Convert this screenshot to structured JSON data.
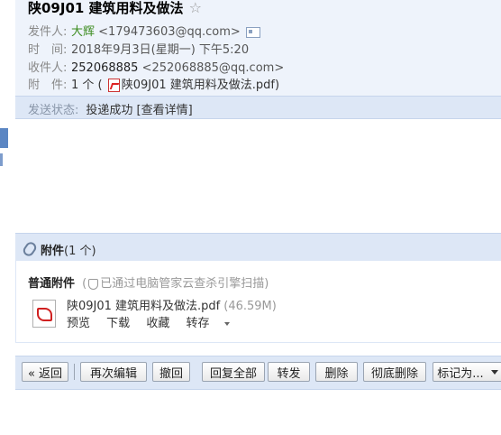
{
  "mail": {
    "subject": "陕09J01 建筑用料及做法",
    "star": "☆",
    "sender": {
      "label": "发件人:",
      "name": "大辉",
      "email": "<179473603@qq.com>"
    },
    "time": {
      "label": "时　间:",
      "value": "2018年9月3日(星期一) 下午5:20"
    },
    "recipient": {
      "label": "收件人:",
      "name": "252068885",
      "email": "<252068885@qq.com>"
    },
    "attachment_summary": {
      "label": "附　件:",
      "prefix": "1 个 (",
      "file": "陕09J01 建筑用料及做法.pdf",
      "suffix": ")"
    },
    "status": {
      "label": "发送状态:",
      "value": "投递成功 [查看详情]"
    }
  },
  "attachments": {
    "title": "附件",
    "count": "(1 个)",
    "type_label": "普通附件",
    "scan_text": "已通过电脑管家云查杀引擎扫描",
    "scan_open": "(",
    "scan_close": ")",
    "file": {
      "name": "陕09J01 建筑用料及做法.pdf",
      "size": "(46.59M)"
    },
    "actions": {
      "preview": "预览",
      "download": "下载",
      "collect": "收藏",
      "transfer": "转存"
    }
  },
  "toolbar": {
    "back": "« 返回",
    "reedit": "再次编辑",
    "recall": "撤回",
    "reply_all": "回复全部",
    "forward": "转发",
    "delete": "删除",
    "delete_forever": "彻底删除",
    "mark_as": "标记为..."
  },
  "colors": {
    "header_bg": "#eef3fb",
    "bar_bg": "#dde7f6",
    "sender_name": "#3c8c1f",
    "accent_tab": "#5b86c3"
  }
}
